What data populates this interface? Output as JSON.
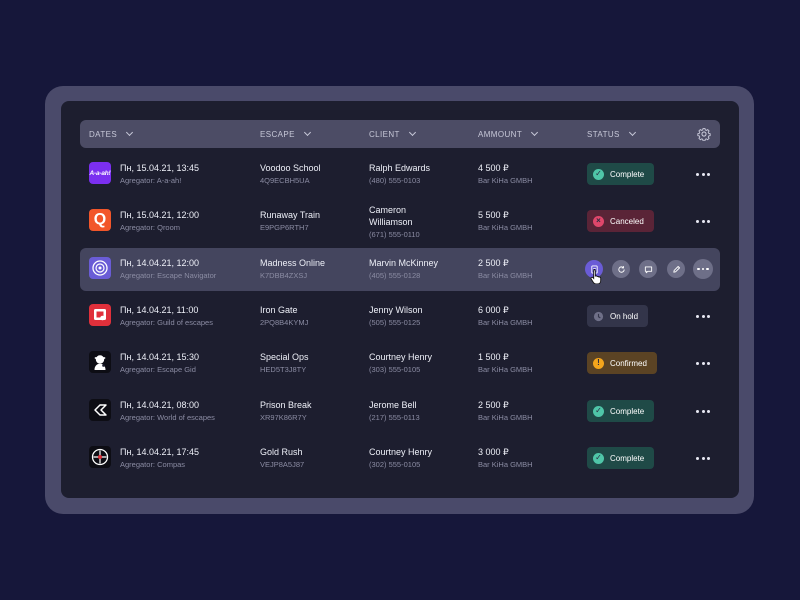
{
  "table": {
    "headers": {
      "dates": "DATES",
      "escape": "ESCAPE",
      "client": "CLIENT",
      "amount": "AMMOUNT",
      "status": "STATUS"
    },
    "rows": [
      {
        "date": "Пн, 15.04.21, 13:45",
        "agregator": "Agregator: A-a-ah!",
        "escape": "Voodoo School",
        "code": "4Q9ECBH5UA",
        "client_lines": [
          "Ralph Edwards"
        ],
        "phone": "(480) 555-0103",
        "amount": "4 500 ₽",
        "company": "Bar KiHa GMBH",
        "status": "Complete",
        "logo": "aaah-logo-icon",
        "logo_text": "A-a-ah!"
      },
      {
        "date": "Пн, 15.04.21, 12:00",
        "agregator": "Agregator: Qroom",
        "escape": "Runaway Train",
        "code": "E9PGP6RTH7",
        "client_lines": [
          "Cameron",
          "Williamson"
        ],
        "phone": "(671) 555-0110",
        "amount": "5 500 ₽",
        "company": "Bar KiHa GMBH",
        "status": "Canceled",
        "logo": "qroom-logo-icon",
        "logo_text": "Q"
      },
      {
        "date": "Пн, 14.04.21, 12:00",
        "agregator": "Agregator: Escape Navigator",
        "escape": "Madness Online",
        "code": "K7DBB4ZXSJ",
        "client_lines": [
          "Marvin McKinney"
        ],
        "phone": "(405) 555-0128",
        "amount": "2 500 ₽",
        "company": "Bar KiHa GMBH",
        "status": "",
        "logo": "escape-navigator-logo-icon",
        "logo_text": ""
      },
      {
        "date": "Пн, 14.04.21, 11:00",
        "agregator": "Agregator: Guild of escapes",
        "escape": "Iron Gate",
        "code": "2PQ8B4KYMJ",
        "client_lines": [
          "Jenny Wilson"
        ],
        "phone": "(505) 555-0125",
        "amount": "6 000 ₽",
        "company": "Bar KiHa GMBH",
        "status": "On hold",
        "logo": "guild-logo-icon",
        "logo_text": ""
      },
      {
        "date": "Пн, 14.04.21, 15:30",
        "agregator": "Agregator:  Escape Gid",
        "escape": "Special Ops",
        "code": "HED5T3J8TY",
        "client_lines": [
          "Courtney Henry"
        ],
        "phone": "(303) 555-0105",
        "amount": "1 500 ₽",
        "company": "Bar KiHa GMBH",
        "status": "Confirmed",
        "logo": "escape-gid-logo-icon",
        "logo_text": ""
      },
      {
        "date": "Пн, 14.04.21, 08:00",
        "agregator": "Agregator: World of escapes",
        "escape": "Prison Break",
        "code": "XR97K86R7Y",
        "client_lines": [
          "Jerome Bell"
        ],
        "phone": "(217) 555-0113",
        "amount": "2 500 ₽",
        "company": "Bar KiHa GMBH",
        "status": "Complete",
        "logo": "world-of-escapes-logo-icon",
        "logo_text": ""
      },
      {
        "date": "Пн, 14.04.21, 17:45",
        "agregator": "Agregator: Compas",
        "escape": "Gold Rush",
        "code": "VEJP8A5J87",
        "client_lines": [
          "Courtney Henry"
        ],
        "phone": "(302) 555-0105",
        "amount": "3 000 ₽",
        "company": "Bar KiHa GMBH",
        "status": "Complete",
        "logo": "compas-logo-icon",
        "logo_text": ""
      }
    ],
    "highlighted_row": 2,
    "highlighted_actions": [
      "receipt-icon",
      "refresh-icon",
      "comment-icon",
      "edit-icon",
      "more-icon"
    ]
  },
  "status_styles": {
    "Complete": {
      "bg": "#1f4a47",
      "dot": "#4fc6a8",
      "glyph": "✓"
    },
    "Canceled": {
      "bg": "#5a2437",
      "dot": "#e0476b",
      "glyph": "×"
    },
    "On hold": {
      "bg": "#33354a",
      "dot": "#8b8ca3",
      "glyph": ""
    },
    "Confirmed": {
      "bg": "#5b4324",
      "dot": "#f4a51c",
      "glyph": "!"
    }
  },
  "colors": {
    "background": "#16173a",
    "panel": "#1d1e2f",
    "header": "#4c4c65",
    "accent": "#6a5cd6"
  }
}
